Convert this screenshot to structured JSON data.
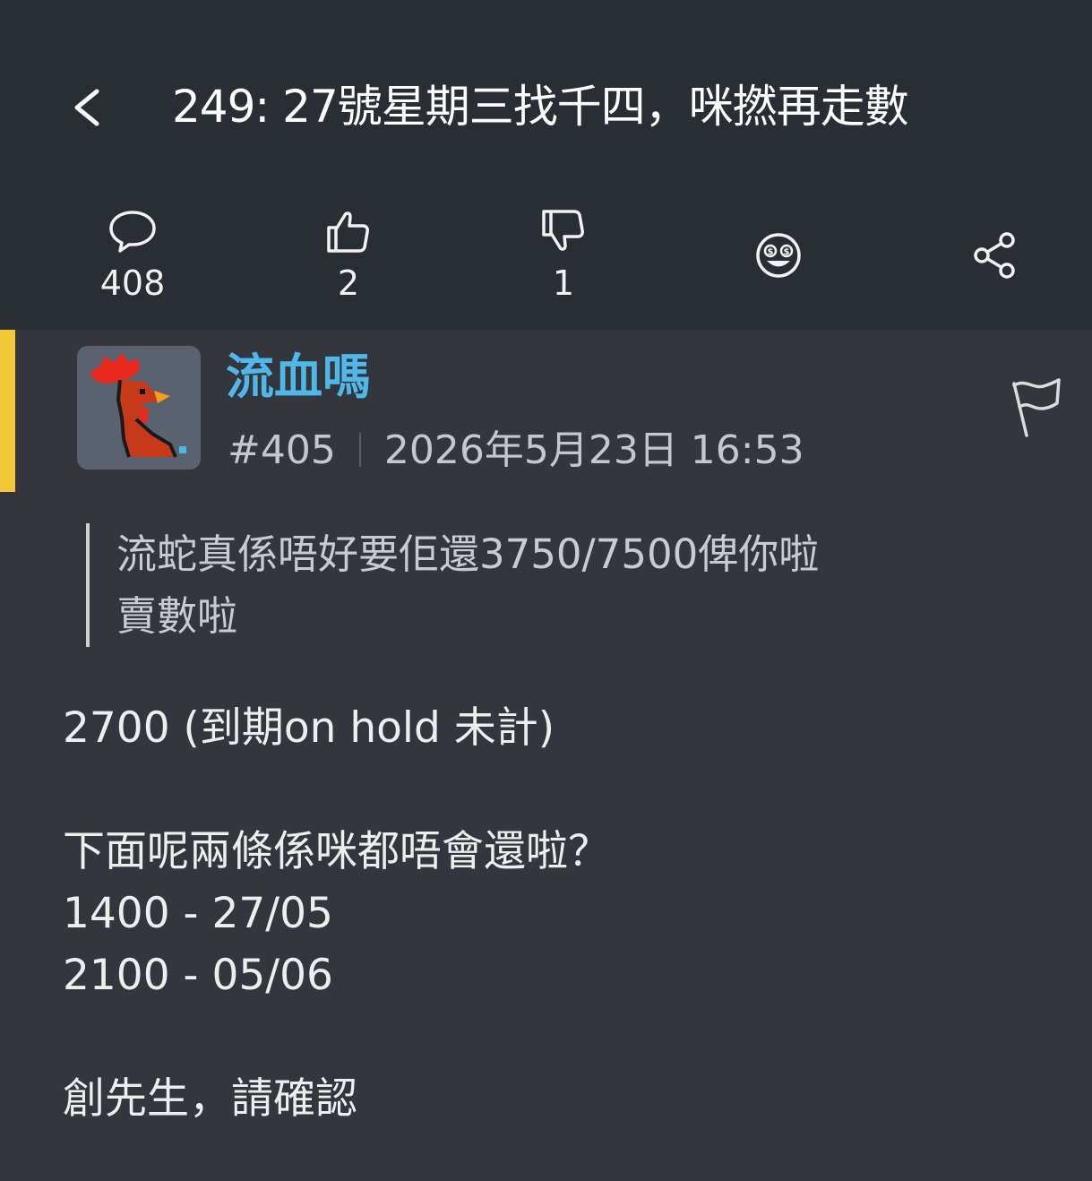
{
  "header": {
    "title": "249: 27號星期三找千四，咪撚再走數",
    "background": "#292d34"
  },
  "stats": {
    "comments": "408",
    "likes": "2",
    "dislikes": "1"
  },
  "icons": {
    "back": "chevron-left-icon",
    "comment": "speech-bubble-icon",
    "like": "thumbs-up-icon",
    "dislike": "thumbs-down-icon",
    "reaction": "money-eyes-face-icon",
    "share": "share-icon",
    "report": "flag-icon"
  },
  "post": {
    "author": "流血嗎",
    "number": "#405",
    "timestamp": "2026年5月23日 16:53",
    "author_color": "#4fb8e8",
    "accent_color": "#f5c83a",
    "quote_lines": [
      "流蛇真係唔好要佢還3750/7500俾你啦",
      "賣數啦"
    ],
    "body_lines": [
      "2700 (到期on hold 未計)",
      "下面呢兩條係咪都唔會還啦？",
      "1400 - 27/05",
      "2100 - 05/06",
      "創先生，請確認"
    ]
  }
}
